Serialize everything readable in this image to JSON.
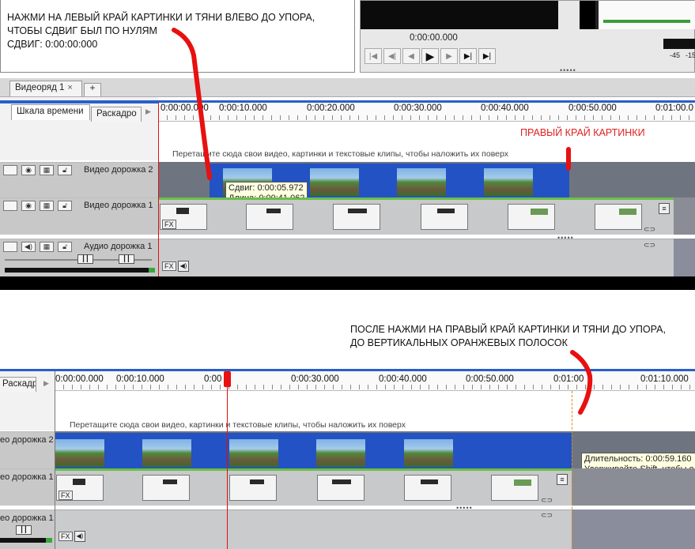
{
  "top": {
    "annotation_line1": "НАЖМИ НА ЛЕВЫЙ КРАЙ КАРТИНКИ И ТЯНИ ВЛЕВО ДО УПОРА,",
    "annotation_line2": "ЧТОБЫ СДВИГ БЫЛ ПО НУЛЯМ",
    "annotation_line3": "СДВИГ: 0:00:00:000",
    "right_edge_label": "ПРАВЫЙ КРАЙ КАРТИНКИ",
    "player": {
      "time": "0:00:00.000",
      "meter_left": "-45",
      "meter_right": "-15"
    },
    "tabs": {
      "sequence_tab": "Видеоряд 1",
      "close_symbol": "×",
      "add_symbol": "+"
    },
    "view_tabs": {
      "timeline": "Шкала времени",
      "storyboard": "Раскадро"
    },
    "ruler_ticks": [
      "0:00:00.000",
      "0:00:10.000",
      "0:00:20.000",
      "0:00:30.000",
      "0:00:40.000",
      "0:00:50.000",
      "0:01:00.0"
    ],
    "drop_hint": "Перетащите сюда свои видео, картинки и текстовые клипы, чтобы наложить их поверх",
    "tracks": {
      "video2": "Видео дорожка 2",
      "video1": "Видео дорожка 1",
      "audio1": "Аудио дорожка 1"
    },
    "tooltip_line1": "Сдвиг: 0:00:05.972",
    "tooltip_line2": "Длина: 0:00:41.062",
    "fx": "FX"
  },
  "bottom": {
    "annotation_line1": "ПОСЛЕ НАЖМИ НА ПРАВЫЙ КРАЙ КАРТИНКИ И ТЯНИ ДО УПОРА,",
    "annotation_line2": "ДО ВЕРТИКАЛЬНЫХ ОРАНЖЕВЫХ ПОЛОСОК",
    "storyboard_tab": "Раскадро",
    "ruler_ticks": [
      "0:00:00.000",
      "0:00:10.000",
      "0:00",
      "0:00:30.000",
      "0:00:40.000",
      "0:00:50.000",
      "0:01:00",
      "0:01:10.000"
    ],
    "drop_hint": "Перетащите сюда свои видео, картинки и текстовые клипы, чтобы наложить их поверх",
    "tracks": {
      "video2": "ео дорожка 2",
      "video1": "еo дорожка 1",
      "audio1": "ео дорожка 1"
    },
    "tooltip_line1": "Длительность: 0:00:59.160",
    "tooltip_line2": "Удерживайте Shift, чтобы о",
    "fx": "FX"
  },
  "colors": {
    "accent_blue": "#2a5ec9",
    "clip_blue": "#2352c4",
    "marker_red": "#e81010",
    "track_green": "#6bbf47",
    "orange_guide": "#e08a1a"
  }
}
